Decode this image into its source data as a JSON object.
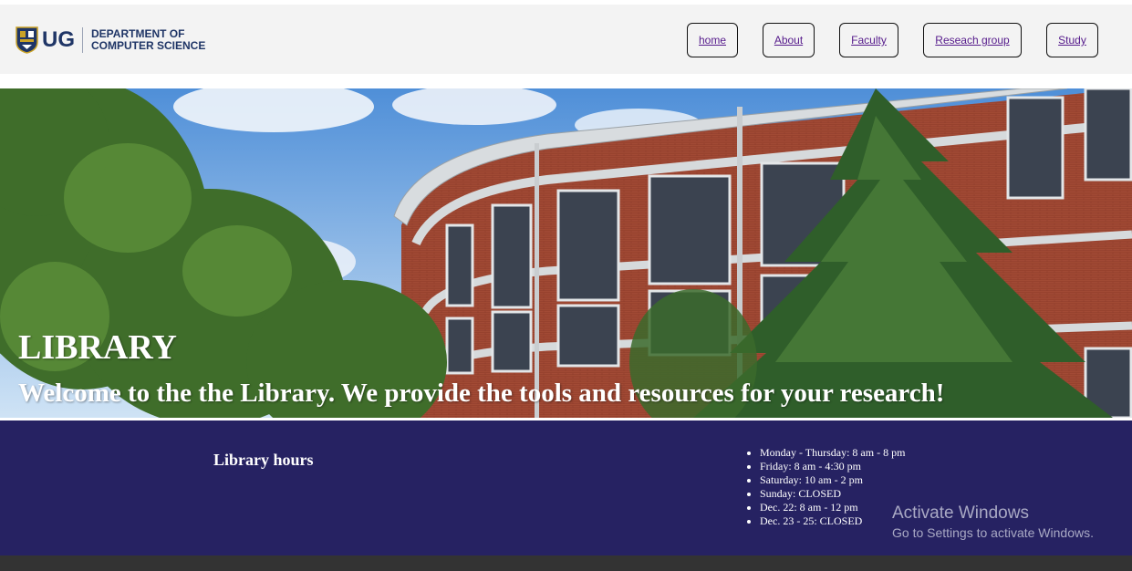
{
  "logo": {
    "abbr": "UG",
    "line1": "DEPARTMENT OF",
    "line2": "COMPUTER SCIENCE"
  },
  "nav": {
    "home": "home",
    "about": "About",
    "faculty": "Faculty",
    "research": "Reseach group",
    "study": "Study"
  },
  "hero": {
    "title": "LIBRARY",
    "subtitle": "Welcome to the the Library. We provide the tools and resources for your research!"
  },
  "hours": {
    "heading": "Library hours",
    "items": [
      "Monday - Thursday: 8 am - 8 pm",
      "Friday: 8 am - 4:30 pm",
      "Saturday: 10 am - 2 pm",
      "Sunday: CLOSED",
      "Dec. 22: 8 am - 12 pm",
      "Dec. 23 - 25: CLOSED"
    ]
  },
  "watermark": {
    "title": "Activate Windows",
    "subtitle": "Go to Settings to activate Windows."
  },
  "colors": {
    "header_bg": "#f3f3f3",
    "brand_navy": "#1f3566",
    "hours_bg": "#262262",
    "footer_bg": "#333333",
    "link": "#551a8b"
  }
}
